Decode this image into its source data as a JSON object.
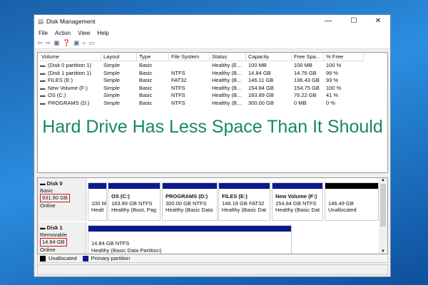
{
  "window": {
    "title": "Disk Management",
    "minimize": "—",
    "maximize": "☐",
    "close": "✕"
  },
  "menu": [
    "File",
    "Action",
    "View",
    "Help"
  ],
  "table": {
    "headers": [
      "Volume",
      "Layout",
      "Type",
      "File System",
      "Status",
      "Capacity",
      "Free Spa...",
      "% Free"
    ],
    "rows": [
      [
        "(Disk 0 partition 1)",
        "Simple",
        "Basic",
        "",
        "Healthy (E...",
        "100 MB",
        "100 MB",
        "100 %"
      ],
      [
        "(Disk 1 partition 1)",
        "Simple",
        "Basic",
        "NTFS",
        "Healthy (B...",
        "14.84 GB",
        "14.76 GB",
        "99 %"
      ],
      [
        "FILES (E:)",
        "Simple",
        "Basic",
        "FAT32",
        "Healthy (B...",
        "146.11 GB",
        "136.43 GB",
        "93 %"
      ],
      [
        "New Volume (F:)",
        "Simple",
        "Basic",
        "NTFS",
        "Healthy (B...",
        "154.84 GB",
        "154.75 GB",
        "100 %"
      ],
      [
        "OS (C:)",
        "Simple",
        "Basic",
        "NTFS",
        "Healthy (B...",
        "183.89 GB",
        "76.22 GB",
        "41 %"
      ],
      [
        "PROGRAMS (D:)",
        "Simple",
        "Basic",
        "NTFS",
        "Healthy (B...",
        "300.00 GB",
        "0 MB",
        "0 %"
      ]
    ]
  },
  "headline": "Hard Drive Has Less Space Than It Should",
  "disk0": {
    "name": "Disk 0",
    "type": "Basic",
    "size": "931.90 GB",
    "state": "Online",
    "partitions": [
      {
        "name": "",
        "l1": "100 M",
        "l2": "Healt"
      },
      {
        "name": "OS  (C:)",
        "l1": "183.89 GB NTFS",
        "l2": "Healthy (Boot, Pag"
      },
      {
        "name": "PROGRAMS  (D:)",
        "l1": "300.00 GB NTFS",
        "l2": "Healthy (Basic Data"
      },
      {
        "name": "FILES  (E:)",
        "l1": "146.18 GB FAT32",
        "l2": "Healthy (Basic Dat"
      },
      {
        "name": "New Volume  (F:)",
        "l1": "154.84 GB NTFS",
        "l2": "Healthy (Basic Dat"
      },
      {
        "name": "",
        "l1": "146.49 GB",
        "l2": "Unallocated"
      }
    ]
  },
  "disk1": {
    "name": "Disk 1",
    "type": "Removable",
    "size": "14.84 GB",
    "state": "Online",
    "partition": {
      "l1": "14.84 GB NTFS",
      "l2": "Healthy (Basic Data Partition)"
    }
  },
  "legend": {
    "unallocated": "Unallocated",
    "primary": "Primary partition"
  },
  "colors": {
    "primary": "#0a1a8c",
    "unallocated": "#000000",
    "headline": "#17895a"
  }
}
